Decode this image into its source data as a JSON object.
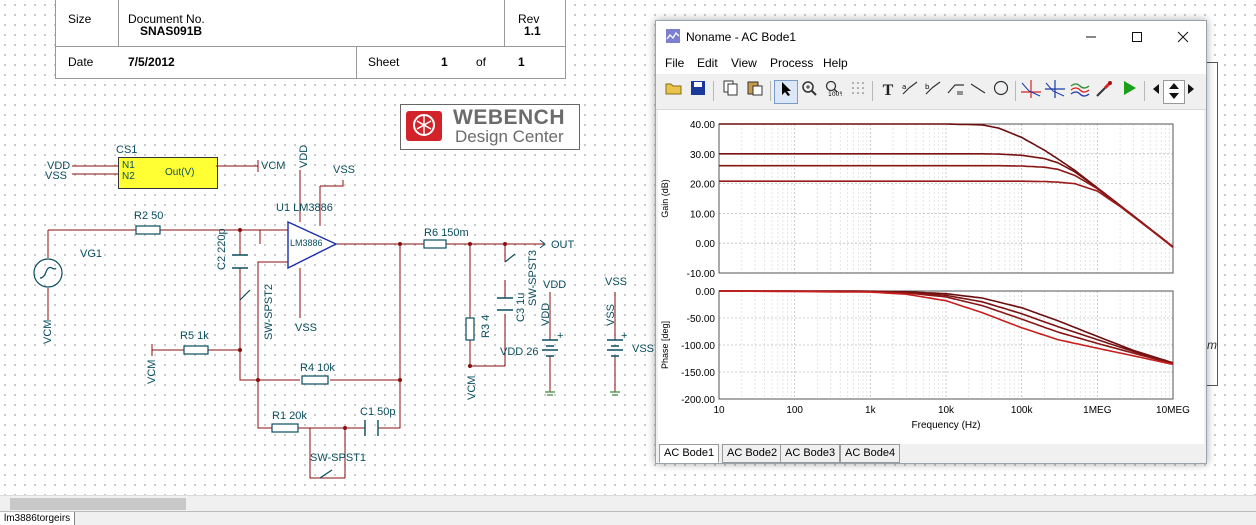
{
  "title_block": {
    "size_label": "Size",
    "docno_label": "Document No.",
    "docno_value": "SNAS091B",
    "rev_label": "Rev",
    "rev_value": "1.1",
    "date_label": "Date",
    "date_value": "7/5/2012",
    "sheet_label": "Sheet",
    "sheet_num": "1",
    "of_label": "of",
    "sheet_total": "1"
  },
  "logo": {
    "line1": "WEBENCH",
    "line2": "Design Center"
  },
  "schematic": {
    "labels": {
      "vdd1": "VDD",
      "vss1": "VSS",
      "cs1": "CS1",
      "n1": "N1",
      "n2": "N2",
      "outv": "Out(V)",
      "vcm1": "VCM",
      "vdd_top": "VDD",
      "vss_top": "VSS",
      "u1": "U1 LM3886",
      "opamp_text": "LM3886",
      "r2": "R2 50",
      "vg1": "VG1",
      "vcm_left": "VCM",
      "c2": "C2 220p",
      "sw2": "SW-SPST2",
      "r5": "R5 1k",
      "vcm_r5": "VCM",
      "vss_bottom": "VSS",
      "r4": "R4 10k",
      "r1": "R1 20k",
      "c1": "C1 50p",
      "sw1": "SW-SPST1",
      "r6": "R6 150m",
      "out": "OUT",
      "sw3": "SW-SPST3",
      "c3": "C3 1u",
      "r3": "R3 4",
      "vcm_r3": "VCM",
      "vdd_src_top": "VDD",
      "vdd_src_left": "VDD",
      "vdd26": "VDD 26",
      "vss_src_top": "VSS",
      "vss_src_left": "VSS",
      "vss_src_right": "VSS",
      "plus": "+",
      "plus2": "+"
    },
    "right_m": "m"
  },
  "window": {
    "title": "Noname - AC Bode1",
    "min_icon": "minimize-icon",
    "max_icon": "maximize-icon",
    "close_icon": "close-icon",
    "menu": [
      "File",
      "Edit",
      "View",
      "Process",
      "Help"
    ],
    "toolbar_icons": [
      "open-folder-icon",
      "save-icon",
      "copy-icon",
      "paste-icon",
      "pointer-icon",
      "zoom-icon",
      "zoom-100-icon",
      "grid-icon",
      "text-icon",
      "cursor-a-icon",
      "cursor-b-icon",
      "slope-icon",
      "line-icon",
      "circle-icon",
      "marker-a-icon",
      "marker-b-icon",
      "waves-icon",
      "probe-icon",
      "run-icon",
      "scroll-left-icon",
      "scroll-updown-icon",
      "scroll-right-icon"
    ],
    "tabs": [
      "AC Bode1",
      "AC Bode2",
      "AC Bode3",
      "AC Bode4"
    ],
    "active_tab": 0
  },
  "chart_data": [
    {
      "type": "line",
      "xscale": "log",
      "xlim": [
        10,
        10000000
      ],
      "ylim": [
        -10,
        40
      ],
      "ylabel": "Gain (dB)",
      "xlabel": "",
      "grid": true,
      "yticks": [
        "40.00",
        "30.00",
        "20.00",
        "10.00",
        "0.00",
        "-10.00"
      ],
      "colors": [
        "#6a0e0e",
        "#7a1212",
        "#8a1616",
        "#9a1a1a"
      ],
      "x": [
        10,
        1000,
        10000,
        30000,
        50000,
        100000,
        200000,
        300000,
        500000,
        1000000,
        2000000,
        5000000,
        10000000
      ],
      "series": [
        {
          "values": [
            40,
            40,
            40,
            39.7,
            38.6,
            35.5,
            31.2,
            28.3,
            24.5,
            18.6,
            12.7,
            4.8,
            -1.2
          ]
        },
        {
          "values": [
            30,
            30,
            30,
            30,
            29.9,
            29.5,
            28.4,
            27.0,
            24.0,
            18.5,
            12.6,
            4.8,
            -1.2
          ]
        },
        {
          "values": [
            26,
            26,
            26,
            26,
            26,
            25.9,
            25.5,
            24.8,
            22.8,
            18.3,
            12.5,
            4.7,
            -1.3
          ]
        },
        {
          "values": [
            20.8,
            20.8,
            20.8,
            20.8,
            20.8,
            20.8,
            20.7,
            20.5,
            20.0,
            17.5,
            12.3,
            4.6,
            -1.4
          ]
        }
      ]
    },
    {
      "type": "line",
      "xscale": "log",
      "xlim": [
        10,
        10000000
      ],
      "ylim": [
        -200,
        0
      ],
      "ylabel": "Phase [deg]",
      "xlabel": "Frequency (Hz)",
      "grid": true,
      "xticks": [
        "10",
        "100",
        "1k",
        "10k",
        "100k",
        "1MEG",
        "10MEG"
      ],
      "yticks": [
        "0.00",
        "-50.00",
        "-100.00",
        "-150.00",
        "-200.00"
      ],
      "colors": [
        "#6a0e0e",
        "#7a1212",
        "#8a1616",
        "#c81e1e"
      ],
      "x": [
        10,
        1000,
        3000,
        10000,
        30000,
        100000,
        300000,
        1000000,
        3000000,
        10000000
      ],
      "series": [
        {
          "values": [
            0,
            -0.3,
            -1.5,
            -5,
            -13,
            -31,
            -55,
            -84,
            -110,
            -133
          ]
        },
        {
          "values": [
            0,
            -0.5,
            -2.5,
            -8,
            -20,
            -42,
            -66,
            -90,
            -112,
            -134
          ]
        },
        {
          "values": [
            0,
            -1,
            -3.5,
            -11,
            -27,
            -52,
            -76,
            -97,
            -115,
            -135
          ]
        },
        {
          "values": [
            0,
            -2,
            -6,
            -18,
            -40,
            -68,
            -90,
            -106,
            -120,
            -136
          ]
        }
      ]
    }
  ],
  "statusbar": {
    "file_tab": "lm3886torgeirs"
  }
}
